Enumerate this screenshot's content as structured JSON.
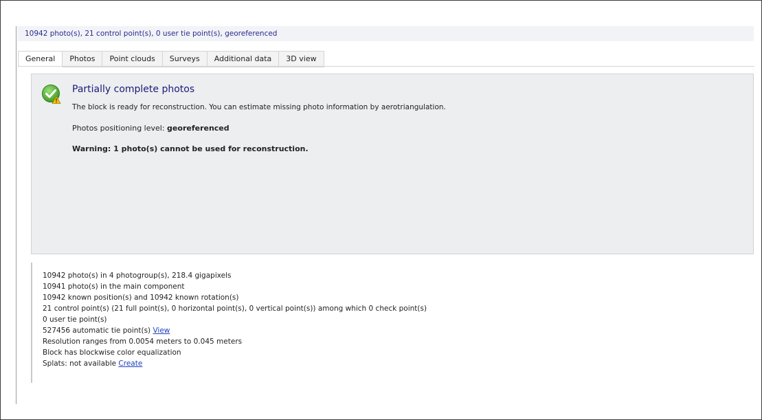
{
  "summary": "10942 photo(s), 21 control point(s), 0 user tie point(s), georeferenced",
  "tabs": [
    {
      "label": "General",
      "active": true
    },
    {
      "label": "Photos"
    },
    {
      "label": "Point clouds"
    },
    {
      "label": "Surveys"
    },
    {
      "label": "Additional data"
    },
    {
      "label": "3D view"
    }
  ],
  "status": {
    "icon": "check-warning-icon",
    "title": "Partially complete photos",
    "description": "The block is ready for reconstruction. You can estimate missing photo information by aerotriangulation.",
    "positioning_label": "Photos positioning level: ",
    "positioning_value": "georeferenced",
    "warning": "Warning: 1 photo(s) cannot be used for reconstruction."
  },
  "details": {
    "photos": "10942 photo(s) in 4 photogroup(s), 218.4 gigapixels",
    "main_component": "10941 photo(s) in the main component",
    "known": "10942 known position(s) and 10942 known rotation(s)",
    "control_points": "21 control point(s) (21 full point(s), 0 horizontal point(s), 0 vertical point(s)) among which 0 check point(s)",
    "user_tie": "0 user tie point(s)",
    "auto_tie_text": "527456 automatic tie point(s) ",
    "auto_tie_link": "View",
    "resolution": "Resolution ranges from 0.0054 meters to 0.045 meters",
    "color_eq": "Block has blockwise color equalization",
    "splats_text": "Splats: not available ",
    "splats_link": "Create"
  },
  "colors": {
    "title": "#1a1a7a",
    "link": "#1f3fbf",
    "check_green": "#5cb83a",
    "warning_yellow": "#f2c200"
  }
}
